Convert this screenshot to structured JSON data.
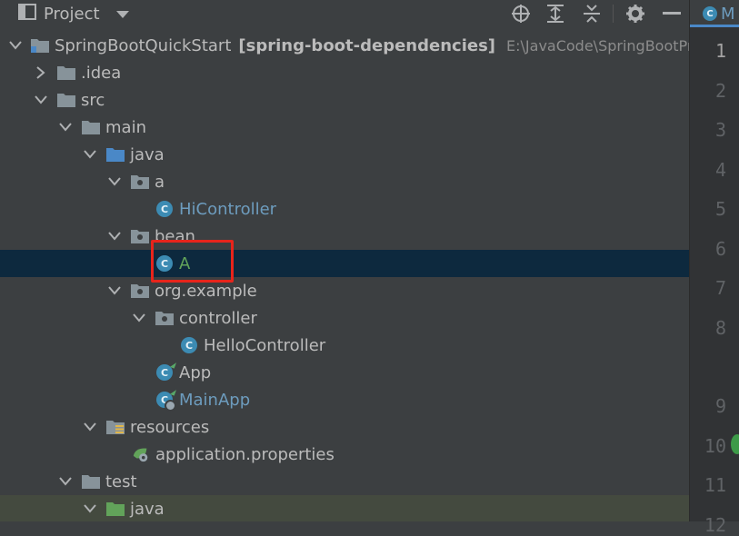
{
  "toolbar": {
    "title": "Project",
    "icons": [
      "project-view-icon",
      "chevron-down-icon",
      "locate-icon",
      "expand-all-icon",
      "collapse-all-icon",
      "gear-icon",
      "hide-icon"
    ]
  },
  "tree": [
    {
      "label": "SpringBootQuickStart",
      "bold": "[spring-boot-dependencies]",
      "path": "E:\\JavaCode\\SpringBootPro",
      "icon": "module-folder-icon",
      "expanded": true
    },
    {
      "label": ".idea",
      "icon": "folder-icon",
      "expanded": false
    },
    {
      "label": "src",
      "icon": "folder-icon",
      "expanded": true
    },
    {
      "label": "main",
      "icon": "folder-icon",
      "expanded": true
    },
    {
      "label": "java",
      "icon": "source-folder-icon",
      "expanded": true
    },
    {
      "label": "a",
      "icon": "package-icon",
      "expanded": true
    },
    {
      "label": "HiController",
      "icon": "class-icon"
    },
    {
      "label": "bean",
      "icon": "package-icon",
      "expanded": true
    },
    {
      "label": "A",
      "icon": "class-icon",
      "selected": true
    },
    {
      "label": "org.example",
      "icon": "package-icon",
      "expanded": true
    },
    {
      "label": "controller",
      "icon": "package-icon",
      "expanded": true
    },
    {
      "label": "HelloController",
      "icon": "class-icon"
    },
    {
      "label": "App",
      "icon": "spring-class-icon"
    },
    {
      "label": "MainApp",
      "icon": "spring-boot-class-icon"
    },
    {
      "label": "resources",
      "icon": "resources-folder-icon",
      "expanded": true
    },
    {
      "label": "application.properties",
      "icon": "spring-properties-icon"
    },
    {
      "label": "test",
      "icon": "folder-icon",
      "expanded": true
    },
    {
      "label": "java",
      "icon": "test-source-folder-icon",
      "expanded": true
    }
  ],
  "editor": {
    "tab_label": "M",
    "line_numbers": [
      "1",
      "2",
      "3",
      "4",
      "5",
      "6",
      "7",
      "8",
      "9",
      "10",
      "11",
      "12"
    ]
  },
  "colors": {
    "background": "#3c3f41",
    "selection": "#0d293e",
    "class_label": "#6d9cbe",
    "modified_label": "#62a35a",
    "highlight_box": "#e8241b"
  }
}
